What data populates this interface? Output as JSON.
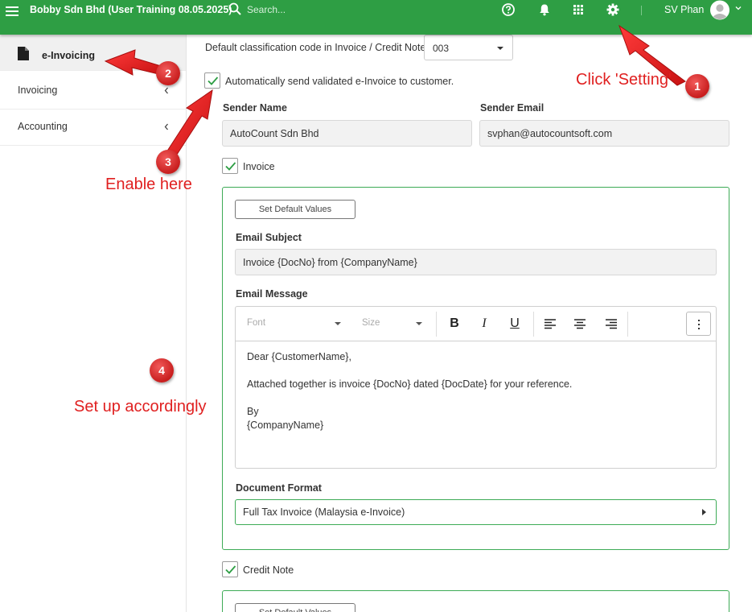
{
  "topbar": {
    "company": "Bobby Sdn Bhd (User Training 08.05.2025)",
    "search_placeholder": "Search...",
    "username": "SV Phan"
  },
  "sidebar": {
    "items": [
      {
        "label": "e-Invoicing",
        "icon": "document-icon",
        "active": true
      },
      {
        "label": "Invoicing",
        "icon": "chevron-left-icon"
      },
      {
        "label": "Accounting",
        "icon": "chevron-left-icon"
      }
    ]
  },
  "settings": {
    "classification_label": "Default classification code in Invoice / Credit Note",
    "classification_value": "003",
    "auto_send_label": "Automatically send validated e-Invoice to customer.",
    "auto_send_checked": true,
    "sender_name_label": "Sender Name",
    "sender_name_value": "AutoCount Sdn Bhd",
    "sender_email_label": "Sender Email",
    "sender_email_value": "svphan@autocountsoft.com",
    "invoice_label": "Invoice",
    "invoice_checked": true,
    "credit_note_label": "Credit Note",
    "credit_note_checked": true
  },
  "invoice_panel": {
    "set_default_label": "Set Default Values",
    "email_subject_label": "Email Subject",
    "email_subject_value": "Invoice {DocNo} from {CompanyName}",
    "email_message_label": "Email Message",
    "toolbar": {
      "font_placeholder": "Font",
      "size_placeholder": "Size",
      "bold": "B",
      "italic": "I",
      "underline": "U"
    },
    "message_lines": [
      "Dear {CustomerName},",
      "",
      "Attached together is invoice {DocNo} dated {DocDate} for your reference.",
      "",
      "By",
      "{CompanyName}"
    ],
    "document_format_label": "Document Format",
    "document_format_value": "Full Tax Invoice (Malaysia e-Invoice)"
  },
  "credit_note_panel": {
    "set_default_label": "Set Default Values"
  },
  "annotations": {
    "badge1": "1",
    "badge2": "2",
    "badge3": "3",
    "badge4": "4",
    "text1": "Click 'Setting'",
    "text3": "Enable here",
    "text4": "Set up accordingly",
    "color": "#e02020"
  },
  "colors": {
    "accent": "#2e9e44",
    "panel_border": "#3dab56"
  }
}
